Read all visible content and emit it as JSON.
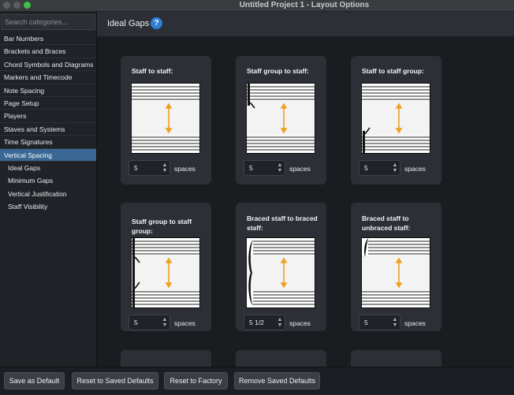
{
  "window": {
    "title": "Untitled Project 1 - Layout Options"
  },
  "sidebar": {
    "search_placeholder": "Search categories...",
    "items": [
      {
        "label": "Bar Numbers"
      },
      {
        "label": "Brackets and Braces"
      },
      {
        "label": "Chord Symbols and Diagrams"
      },
      {
        "label": "Markers and Timecode"
      },
      {
        "label": "Note Spacing"
      },
      {
        "label": "Page Setup"
      },
      {
        "label": "Players"
      },
      {
        "label": "Staves and Systems"
      },
      {
        "label": "Time Signatures"
      },
      {
        "label": "Vertical Spacing",
        "selected": true
      },
      {
        "label": "Ideal Gaps",
        "sub": true
      },
      {
        "label": "Minimum Gaps",
        "sub": true
      },
      {
        "label": "Vertical Justification",
        "sub": true
      },
      {
        "label": "Staff Visibility",
        "sub": true
      }
    ]
  },
  "main": {
    "title": "Ideal Gaps",
    "help_glyph": "?",
    "cards": [
      {
        "label": "Staff to staff:",
        "value": "5",
        "unit": "spaces"
      },
      {
        "label": "Staff group to staff:",
        "value": "5",
        "unit": "spaces"
      },
      {
        "label": "Staff to staff group:",
        "value": "5",
        "unit": "spaces"
      },
      {
        "label": "Staff group to staff group:",
        "value": "5",
        "unit": "spaces"
      },
      {
        "label": "Braced staff to braced staff:",
        "value": "5 1/2",
        "unit": "spaces"
      },
      {
        "label": "Braced staff to unbraced staff:",
        "value": "5",
        "unit": "spaces"
      }
    ]
  },
  "buttons": {
    "save_default": "Save as Default",
    "reset_saved": "Reset to Saved Defaults",
    "reset_factory": "Reset to Factory",
    "remove_saved": "Remove Saved Defaults"
  },
  "colors": {
    "accent": "#3a6794",
    "arrow": "#f0a020",
    "help": "#2d7fd8"
  }
}
